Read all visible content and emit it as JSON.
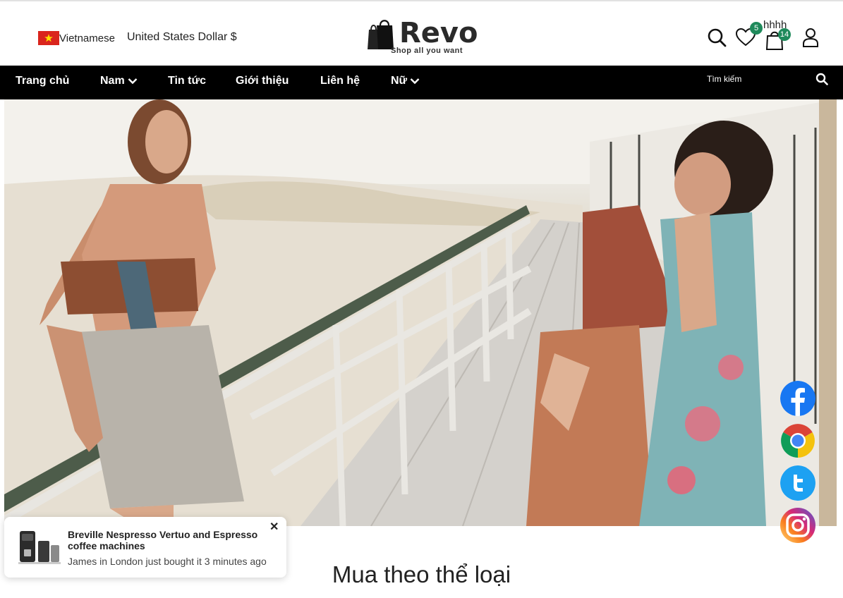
{
  "header": {
    "language": "Vietnamese",
    "currency": "United States Dollar $",
    "logo_text": "Revo",
    "logo_tagline": "Shop all you want",
    "wishlist_count": "5",
    "cart_count": "14",
    "cart_label": "hhhh"
  },
  "nav": {
    "items": [
      {
        "label": "Trang chủ"
      },
      {
        "label": "Nam"
      },
      {
        "label": "Tin tức"
      },
      {
        "label": "Giới thiệu"
      },
      {
        "label": "Liên hệ"
      },
      {
        "label": "Nữ"
      }
    ],
    "search_placeholder": "Tìm kiếm"
  },
  "social": [
    "facebook-icon",
    "chrome-icon",
    "twitter-icon",
    "instagram-icon"
  ],
  "toast": {
    "title": "Breville Nespresso Vertuo and Espresso coffee machines",
    "subtitle": "James in London just bought it 3 minutes ago",
    "close": "✕"
  },
  "section": {
    "title": "Mua theo thể loại"
  },
  "colors": {
    "nav_bg": "#000000",
    "badge": "#1f8a5b",
    "flag_red": "#da251d"
  }
}
